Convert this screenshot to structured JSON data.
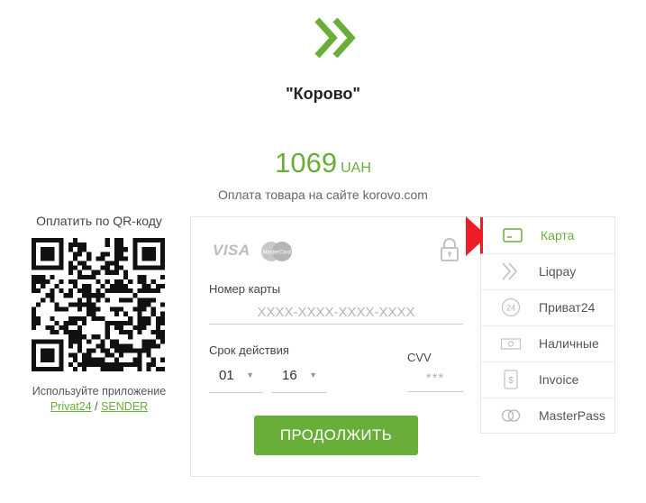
{
  "merchant": {
    "name": "\"Корово\""
  },
  "payment": {
    "amount": "1069",
    "currency": "UAH",
    "description": "Оплата товара на сайте korovo.com"
  },
  "qr": {
    "title": "Оплатить по QR-коду",
    "hint": "Используйте приложение",
    "link1": "Privat24",
    "separator": " / ",
    "link2": "SENDER"
  },
  "card_form": {
    "visa_text": "VISA",
    "mastercard_text": "MasterCard",
    "card_number_label": "Номер карты",
    "card_number_placeholder": "XXXX-XXXX-XXXX-XXXX",
    "expiry_label": "Срок действия",
    "month_value": "01",
    "year_value": "16",
    "cvv_label": "CVV",
    "cvv_placeholder": "***",
    "continue_label": "ПРОДОЛЖИТЬ"
  },
  "methods": [
    {
      "label": "Карта",
      "icon": "card-icon",
      "active": true
    },
    {
      "label": "Liqpay",
      "icon": "liqpay-icon",
      "active": false
    },
    {
      "label": "Приват24",
      "icon": "privat24-icon",
      "active": false
    },
    {
      "label": "Наличные",
      "icon": "cash-icon",
      "active": false
    },
    {
      "label": "Invoice",
      "icon": "invoice-icon",
      "active": false
    },
    {
      "label": "MasterPass",
      "icon": "masterpass-icon",
      "active": false
    }
  ],
  "colors": {
    "accent": "#6aae3a",
    "pointer": "#ee1c24",
    "border": "#e6e6e6"
  }
}
